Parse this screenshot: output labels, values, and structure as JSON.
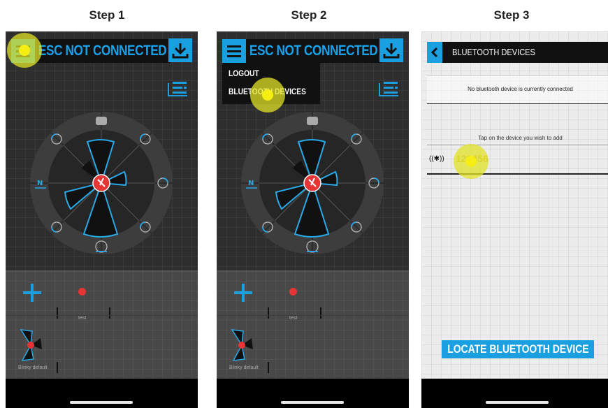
{
  "steps": [
    {
      "title": "Step 1"
    },
    {
      "title": "Step 2"
    },
    {
      "title": "Step 3"
    }
  ],
  "header": {
    "status": "ESC NOT CONNECTED"
  },
  "wheel": {
    "left_label": "N"
  },
  "panel": {
    "preset_label": "test",
    "default_label": "Blinky default"
  },
  "menu": {
    "items": [
      "LOGOUT",
      "BLUETOOTH DEVICES"
    ]
  },
  "bluetooth": {
    "title": "BLUETOOTH DEVICES",
    "notice": "No bluetooth device is currently connected",
    "instruction": "Tap on the device you wish to add",
    "device_symbol": "((✱))",
    "device_name": "123456",
    "locate_button": "LOCATE BLUETOOTH DEVICE"
  },
  "colors": {
    "accent": "#1a9fe0",
    "tap_highlight": "#e8e428",
    "alert_red": "#e53535"
  }
}
